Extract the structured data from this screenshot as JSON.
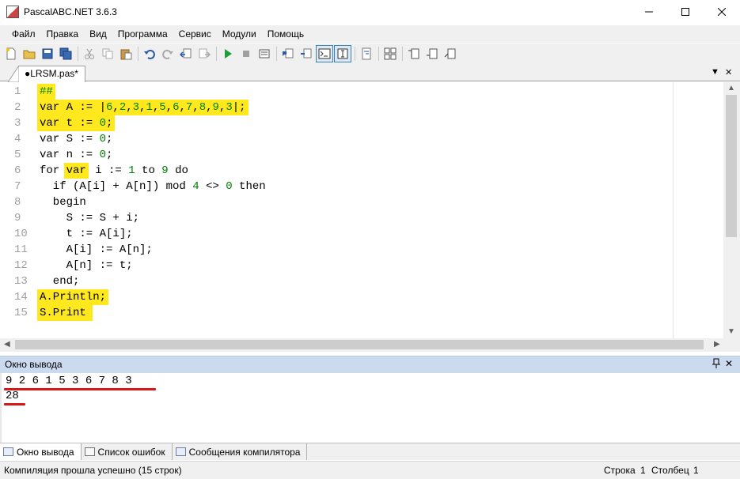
{
  "window": {
    "title": "PascalABC.NET 3.6.3",
    "icon_label": "AB CABC"
  },
  "menu": [
    "Файл",
    "Правка",
    "Вид",
    "Программа",
    "Сервис",
    "Модули",
    "Помощь"
  ],
  "editor_tab": {
    "label": "●LRSM.pas*"
  },
  "code": {
    "line_numbers": [
      "1",
      "2",
      "3",
      "4",
      "5",
      "6",
      "7",
      "8",
      "9",
      "10",
      "11",
      "12",
      "13",
      "14",
      "15"
    ],
    "lines": [
      "##",
      "var A := |6,2,3,1,5,6,7,8,9,3|;",
      "var t := 0;",
      "var S := 0;",
      "var n := 0;",
      "for var i := 1 to 9 do",
      "  if (A[i] + A[n]) mod 4 <> 0 then",
      "  begin",
      "    S := S + i;",
      "    t := A[i];",
      "    A[i] := A[n];",
      "    A[n] := t;",
      "  end;",
      "A.Println;",
      "S.Print"
    ]
  },
  "output": {
    "title": "Окно вывода",
    "lines": [
      "9 2 6 1 5 3 6 7 8 3",
      "28"
    ]
  },
  "bottom_tabs": [
    "Окно вывода",
    "Список ошибок",
    "Сообщения компилятора"
  ],
  "status": {
    "message": "Компиляция прошла успешно (15 строк)",
    "row_label": "Строка",
    "row_value": "1",
    "col_label": "Столбец",
    "col_value": "1"
  },
  "colors": {
    "highlight": "#ffe81e",
    "number": "#008000",
    "underline": "#d81818",
    "output_header": "#ccdaf0"
  }
}
